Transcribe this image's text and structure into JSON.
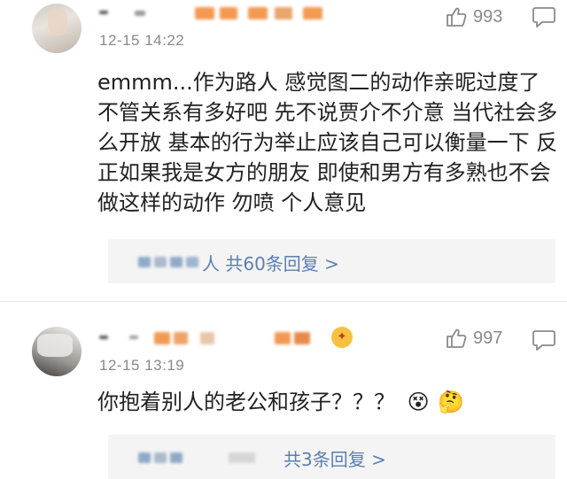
{
  "comments": [
    {
      "time": "12-15 14:22",
      "likes": "993",
      "text": "emmm...作为路人 感觉图二的动作亲昵过度了 不管关系有多好吧 先不说贾介不介意 当代社会多么开放 基本的行为举止应该自己可以衡量一下 反正如果我是女方的朋友 即使和男方有多熟也不会做这样的动作  勿喷 个人意见",
      "reply_link": "人 共60条回复 >"
    },
    {
      "time": "12-15 13:19",
      "likes": "997",
      "text": "你抱着别人的老公和孩子？？？",
      "emoji": [
        "😵",
        "🤔"
      ],
      "reply_link": "共3条回复 >"
    }
  ],
  "colors": {
    "link": "#5b7fb0",
    "meta": "#8a8a8a",
    "reply_bg": "#f4f4f4",
    "blur_orange": "#f39a52",
    "blur_blue": "#8fa9c9"
  },
  "icons": [
    "thumbs-up-icon",
    "reply-bubble-icon",
    "verified-badge-icon"
  ]
}
